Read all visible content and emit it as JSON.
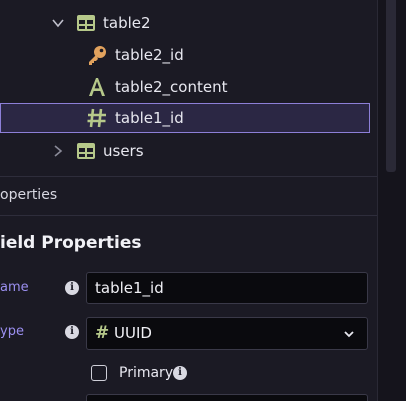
{
  "tree": {
    "items": [
      {
        "label": "table2",
        "type": "table",
        "expanded": true
      },
      {
        "label": "table2_id",
        "type": "primary-key"
      },
      {
        "label": "table2_content",
        "type": "text"
      },
      {
        "label": "table1_id",
        "type": "uuid",
        "selected": true
      },
      {
        "label": "users",
        "type": "table",
        "expanded": false
      }
    ]
  },
  "properties_panel": {
    "header": "operties"
  },
  "field_properties": {
    "title": "ield Properties",
    "name_label": "ame",
    "name_value": "table1_id",
    "type_label": "ype",
    "type_value": "UUID",
    "type_icon": "#",
    "primary_label": "Primary",
    "primary_checked": false
  },
  "colors": {
    "background": "#1b1a24",
    "accent": "#8d7fd8",
    "label_accent": "#9b8ff0",
    "table_icon": "#b6c88a",
    "key_icon": "#e2a25d"
  }
}
